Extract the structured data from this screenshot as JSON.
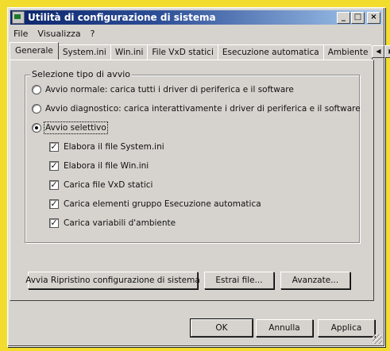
{
  "window": {
    "title": "Utilità di configurazione di sistema"
  },
  "titlebar_buttons": {
    "minimize": "_",
    "maximize": "□",
    "close": "×"
  },
  "menu": {
    "items": [
      "File",
      "Visualizza",
      "?"
    ]
  },
  "tabs": [
    "Generale",
    "System.ini",
    "Win.ini",
    "File VxD statici",
    "Esecuzione automatica",
    "Ambiente"
  ],
  "tab_scroll": {
    "left": "◀",
    "right": "▶"
  },
  "startup_group": {
    "legend": "Selezione tipo di avvio",
    "normal": "Avvio normale: carica tutti i driver di periferica e il software",
    "diagnostic": "Avvio diagnostico: carica interattivamente i driver di periferica e il software",
    "selective": "Avvio selettivo",
    "selected_mode": "selective",
    "options": [
      {
        "label": "Elabora il file System.ini",
        "checked": true
      },
      {
        "label": "Elabora il file Win.ini",
        "checked": true
      },
      {
        "label": "Carica file VxD statici",
        "checked": true
      },
      {
        "label": "Carica elementi gruppo Esecuzione automatica",
        "checked": true
      },
      {
        "label": "Carica variabili d'ambiente",
        "checked": true
      }
    ]
  },
  "actions": {
    "restore": "Avvia Ripristino configurazione di sistema",
    "extract": "Estrai file...",
    "advanced": "Avanzate..."
  },
  "footer": {
    "ok": "OK",
    "cancel": "Annulla",
    "apply": "Applica"
  },
  "colors": {
    "title_start": "#0a246a",
    "title_end": "#a6caf0",
    "face": "#d6d3ce",
    "frame": "#f2dc2e"
  }
}
